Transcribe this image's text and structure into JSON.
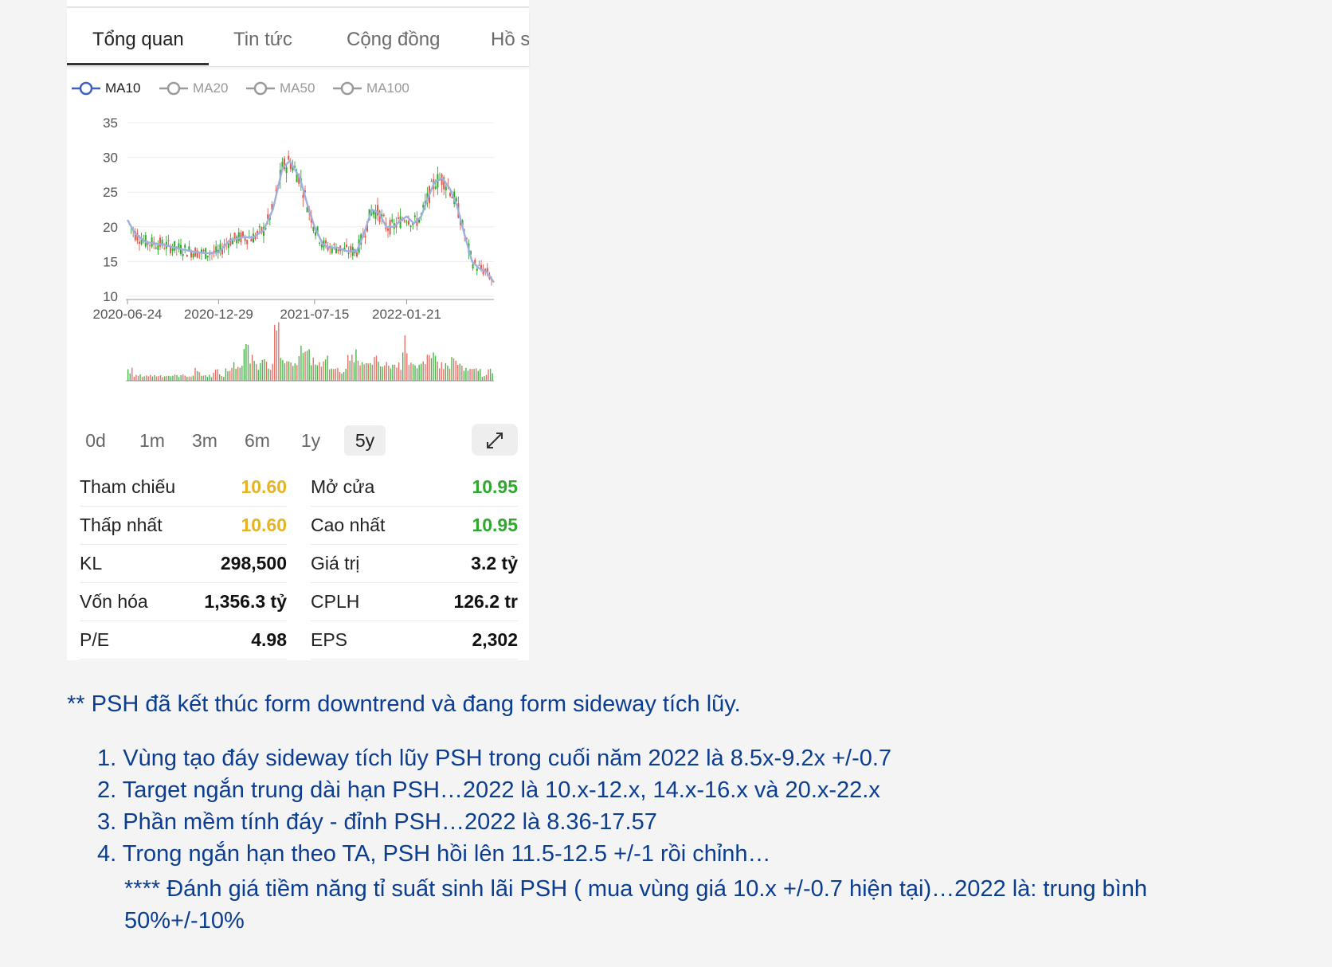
{
  "tabs": [
    {
      "label": "Tổng quan",
      "active": true
    },
    {
      "label": "Tin tức",
      "active": false
    },
    {
      "label": "Cộng đồng",
      "active": false
    },
    {
      "label": "Hồ s",
      "active": false
    }
  ],
  "ma_legend": [
    {
      "label": "MA10",
      "active": true,
      "color": "#3f5fbf"
    },
    {
      "label": "MA20",
      "active": false,
      "color": "#9a9a9a"
    },
    {
      "label": "MA50",
      "active": false,
      "color": "#9a9a9a"
    },
    {
      "label": "MA100",
      "active": false,
      "color": "#9a9a9a"
    }
  ],
  "chart_data": {
    "type": "line",
    "series": [
      {
        "name": "MA10",
        "x": [
          "2020-06-24",
          "2020-07-10",
          "2020-08-01",
          "2020-09-01",
          "2020-10-01",
          "2020-11-01",
          "2020-12-01",
          "2020-12-29",
          "2021-01-20",
          "2021-02-15",
          "2021-03-10",
          "2021-04-01",
          "2021-04-20",
          "2021-05-10",
          "2021-05-25",
          "2021-06-15",
          "2021-07-01",
          "2021-07-15",
          "2021-08-01",
          "2021-08-15",
          "2021-09-01",
          "2021-09-20",
          "2021-10-10",
          "2021-10-25",
          "2021-11-10",
          "2021-11-25",
          "2021-12-10",
          "2021-12-25",
          "2022-01-10",
          "2022-01-21",
          "2022-02-05",
          "2022-02-20",
          "2022-03-05",
          "2022-03-20",
          "2022-04-05",
          "2022-04-20",
          "2022-05-05",
          "2022-05-20",
          "2022-06-05",
          "2022-06-20",
          "2022-07-05",
          "2022-07-20"
        ],
        "values": [
          21.0,
          19.0,
          17.8,
          17.5,
          17.0,
          16.5,
          16.2,
          16.3,
          18.0,
          18.5,
          18.5,
          19.5,
          22.5,
          28.5,
          29.5,
          27.0,
          23.0,
          20.0,
          17.5,
          17.0,
          17.0,
          16.5,
          16.5,
          19.0,
          22.5,
          22.0,
          20.0,
          20.0,
          21.0,
          21.5,
          20.5,
          21.5,
          24.0,
          26.5,
          27.0,
          25.5,
          23.0,
          19.0,
          15.0,
          14.0,
          13.5,
          12.0
        ]
      }
    ],
    "ohlc_note": "candlestick price 2020-06-24 to 2022-07; volume bars below",
    "ylim": [
      10,
      35
    ],
    "yticks": [
      35,
      30,
      25,
      20,
      15,
      10
    ],
    "xticks": [
      "2020-06-24",
      "2020-12-29",
      "2021-07-15",
      "2022-01-21"
    ],
    "grid": true,
    "legend": "top-left",
    "volume": {
      "type": "bar",
      "values": [
        2,
        1,
        1,
        1,
        1,
        1,
        1,
        1,
        1,
        1,
        1,
        2,
        1,
        1,
        2,
        1,
        2,
        3,
        3,
        6,
        4,
        3,
        5,
        3,
        9,
        4,
        3,
        4,
        6,
        5,
        4,
        3,
        4,
        3,
        2,
        2,
        4,
        5,
        3,
        3,
        4,
        3,
        3,
        3,
        3,
        7,
        4,
        3,
        3,
        4,
        5,
        3,
        3,
        4,
        3,
        2,
        2,
        2,
        1,
        2
      ]
    }
  },
  "periods": [
    {
      "label": "0d",
      "active": false
    },
    {
      "label": "1m",
      "active": false
    },
    {
      "label": "3m",
      "active": false
    },
    {
      "label": "6m",
      "active": false
    },
    {
      "label": "1y",
      "active": false
    },
    {
      "label": "5y",
      "active": true
    }
  ],
  "expand_icon": "expand-icon",
  "stats": [
    [
      {
        "label": "Tham chiếu",
        "value": "10.60",
        "color": "yellow"
      },
      {
        "label": "Mở cửa",
        "value": "10.95",
        "color": "green"
      }
    ],
    [
      {
        "label": "Thấp nhất",
        "value": "10.60",
        "color": "yellow"
      },
      {
        "label": "Cao nhất",
        "value": "10.95",
        "color": "green"
      }
    ],
    [
      {
        "label": "KL",
        "value": "298,500",
        "color": "default"
      },
      {
        "label": "Giá trị",
        "value": "3.2 tỷ",
        "color": "default"
      }
    ],
    [
      {
        "label": "Vốn hóa",
        "value": "1,356.3 tỷ",
        "color": "default"
      },
      {
        "label": "CPLH",
        "value": "126.2 tr",
        "color": "default"
      }
    ],
    [
      {
        "label": "P/E",
        "value": "4.98",
        "color": "default"
      },
      {
        "label": "EPS",
        "value": "2,302",
        "color": "default"
      }
    ]
  ],
  "colors": {
    "up": "#2ea82e",
    "down": "#e05a4f",
    "ma10": "#9fb0dd",
    "reference": "#e6b326",
    "text_blue": "#0b3d91"
  },
  "analysis": {
    "headline": "** PSH đã kết thúc form downtrend và đang form sideway tích lũy.",
    "points": [
      "1. Vùng tạo đáy sideway tích lũy PSH trong cuối năm 2022 là 8.5x-9.2x +/-0.7",
      "2. Target ngắn trung dài hạn PSH…2022 là 10.x-12.x, 14.x-16.x và 20.x-22.x",
      "3. Phần mềm tính đáy - đỉnh PSH…2022 là 8.36-17.57",
      "4. Trong ngắn hạn theo TA, PSH hồi lên 11.5-12.5 +/-1 rồi chỉnh…"
    ],
    "evaluation": "**** Đánh giá tiềm năng tỉ suất sinh lãi PSH ( mua vùng giá 10.x +/-0.7 hiện tại)…2022 là: trung bình 50%+/-10%"
  }
}
